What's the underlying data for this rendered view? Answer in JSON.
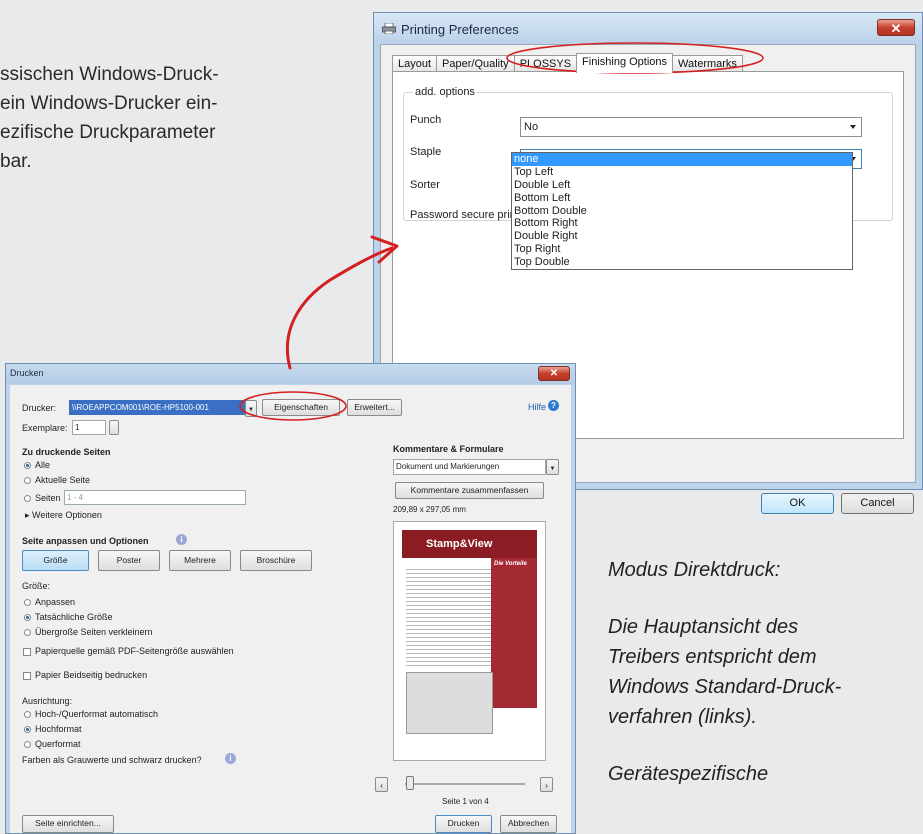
{
  "intro_lines": [
    "ssischen Windows-Druck-",
    "ein Windows-Drucker ein-",
    "ezifische  Druckparameter",
    "bar."
  ],
  "side_note": {
    "heading": "Modus Direktdruck:",
    "para1_lines": [
      "Die Hauptansicht des",
      "Treibers entspricht dem",
      "Windows Standard-Druck-",
      "verfahren (links)."
    ],
    "para2_line": "Gerätespezifische"
  },
  "printing_preferences": {
    "title": "Printing Preferences",
    "tabs": [
      "Layout",
      "Paper/Quality",
      "PLOSSYS",
      "Finishing Options",
      "Watermarks"
    ],
    "active_tab": "Finishing Options",
    "group_label": "add. options",
    "fields": {
      "punch_label": "Punch",
      "punch_value": "No",
      "staple_label": "Staple",
      "staple_value": "none",
      "sorter_label": "Sorter",
      "password_label": "Password secure print"
    },
    "staple_options": [
      "none",
      "Top Left",
      "Double Left",
      "Bottom Left",
      "Bottom Double",
      "Bottom Right",
      "Double Right",
      "Top Right",
      "Top Double"
    ],
    "ok_label": "OK",
    "cancel_label": "Cancel",
    "close_glyph": "✕"
  },
  "drucken": {
    "title": "Drucken",
    "printer_label": "Drucker:",
    "printer_value": "\\\\ROEAPPCOM001\\ROE-HP5100-001",
    "properties_button": "Eigenschaften",
    "advanced_button": "Erweitert...",
    "help_link": "Hilfe",
    "copies_label": "Exemplare:",
    "copies_value": "1",
    "pages_heading": "Zu druckende Seiten",
    "pages_all": "Alle",
    "pages_current": "Aktuelle Seite",
    "pages_range": "Seiten",
    "pages_range_value": "1 - 4",
    "more_options": "Weitere Optionen",
    "fit_heading": "Seite anpassen und Optionen",
    "fit_buttons": [
      "Größe",
      "Poster",
      "Mehrere",
      "Broschüre"
    ],
    "size_heading": "Größe:",
    "size_fit": "Anpassen",
    "size_actual": "Tatsächliche Größe",
    "size_shrink": "Übergroße Seiten verkleinern",
    "paper_source": "Papierquelle gemäß PDF-Seitengröße auswählen",
    "duplex": "Papier Beidseitig bedrucken",
    "orientation_heading": "Ausrichtung:",
    "orient_auto": "Hoch-/Querformat automatisch",
    "orient_portrait": "Hochformat",
    "orient_landscape": "Querformat",
    "grayscale": "Farben als Grauwerte und schwarz drucken?",
    "comments_heading": "Kommentare & Formulare",
    "comments_value": "Dokument und Markierungen",
    "summarize_button": "Kommentare zusammenfassen",
    "page_size": "209,89 x 297,05 mm",
    "preview_title": "Stamp&View",
    "preview_sidebar_title": "Die Vorteile",
    "page_indicator": "Seite 1 von 4",
    "page_setup_button": "Seite einrichten...",
    "print_button": "Drucken",
    "cancel_button": "Abbrechen",
    "close_glyph": "✕"
  }
}
